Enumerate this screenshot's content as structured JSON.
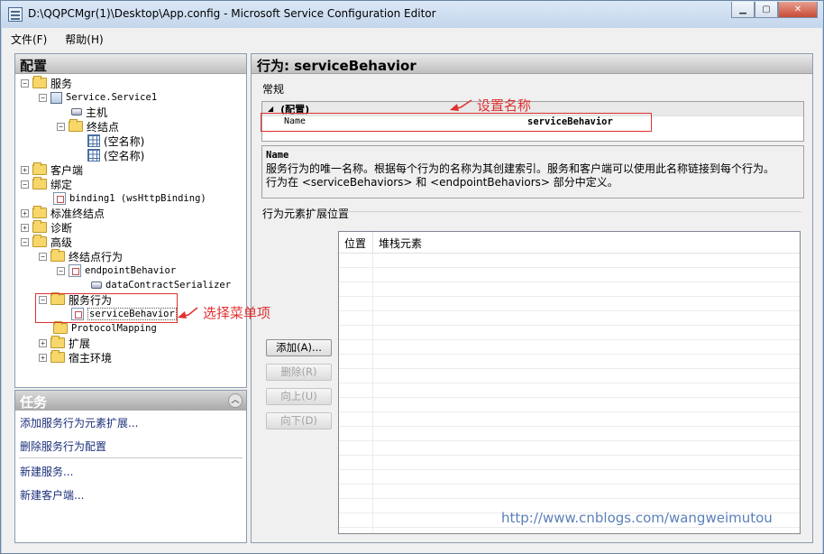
{
  "window": {
    "title": "D:\\QQPCMgr(1)\\Desktop\\App.config - Microsoft Service Configuration Editor",
    "buttons": [
      "▁",
      "▢",
      "✕"
    ]
  },
  "menu": [
    "文件(F)",
    "帮助(H)"
  ],
  "config_panel": {
    "title": "配置",
    "tree": [
      {
        "label": "服务",
        "expander": "−"
      },
      {
        "label": "Service.Service1",
        "expander": "−"
      },
      {
        "label": "主机"
      },
      {
        "label": "终结点",
        "expander": "−"
      },
      {
        "label": "(空名称)"
      },
      {
        "label": "(空名称)"
      },
      {
        "label": "客户端",
        "expander": "+"
      },
      {
        "label": "绑定",
        "expander": "−"
      },
      {
        "label": "binding1 (wsHttpBinding)"
      },
      {
        "label": "标准终结点",
        "expander": "+"
      },
      {
        "label": "诊断",
        "expander": "+"
      },
      {
        "label": "高级",
        "expander": "−"
      },
      {
        "label": "终结点行为",
        "expander": "−"
      },
      {
        "label": "endpointBehavior",
        "expander": "−"
      },
      {
        "label": "dataContractSerializer"
      },
      {
        "label": "服务行为",
        "expander": "−"
      },
      {
        "label": "serviceBehavior"
      },
      {
        "label": "ProtocolMapping"
      },
      {
        "label": "扩展",
        "expander": "+"
      },
      {
        "label": "宿主环境",
        "expander": "+"
      }
    ]
  },
  "tasks_panel": {
    "title": "任务",
    "links": [
      "添加服务行为元素扩展...",
      "删除服务行为配置",
      "新建服务...",
      "新建客户端..."
    ]
  },
  "behavior_panel": {
    "title": "行为: serviceBehavior",
    "general_label": "常规",
    "category": "(配置)",
    "category_glyph": "◢",
    "property_name": "Name",
    "property_value": "serviceBehavior",
    "desc_title": "Name",
    "desc_line1": "服务行为的唯一名称。根据每个行为的名称为其创建索引。服务和客户端可以使用此名称链接到每个行为。",
    "desc_line2": "行为在 <serviceBehaviors> 和 <endpointBehaviors> 部分中定义。",
    "extension_label": "行为元素扩展位置",
    "columns": [
      "位置",
      "堆栈元素"
    ],
    "buttons": [
      {
        "label": "添加(A)...",
        "enabled": true
      },
      {
        "label": "删除(R)",
        "enabled": false
      },
      {
        "label": "向上(U)",
        "enabled": false
      },
      {
        "label": "向下(D)",
        "enabled": false
      }
    ]
  },
  "annotations": {
    "set_name": "设置名称",
    "select_item": "选择菜单项",
    "color": "#e03030"
  },
  "watermark": "http://www.cnblogs.com/wangweimutou"
}
